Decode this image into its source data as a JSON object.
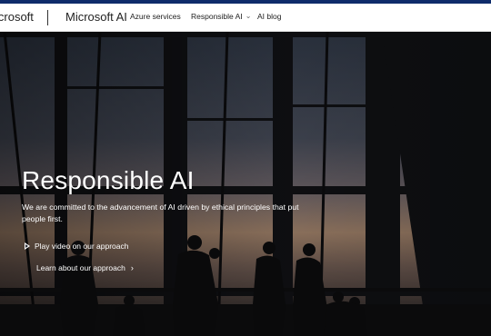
{
  "header": {
    "brand": "icrosoft",
    "product": "Microsoft AI",
    "links": [
      "Azure services",
      "Responsible AI",
      "AI blog"
    ]
  },
  "hero": {
    "title": "Responsible AI",
    "description": "We are committed to the advancement of AI driven by ethical principles that put people first.",
    "cta_video": "Play video on our approach",
    "cta_learn": "Learn about our approach"
  },
  "colors": {
    "top_strip": "#0f2c6b",
    "nav_bg": "#ffffff",
    "hero_text": "#ffffff"
  },
  "icons": [
    "chevron-down-icon",
    "play-icon",
    "chevron-right-icon"
  ]
}
